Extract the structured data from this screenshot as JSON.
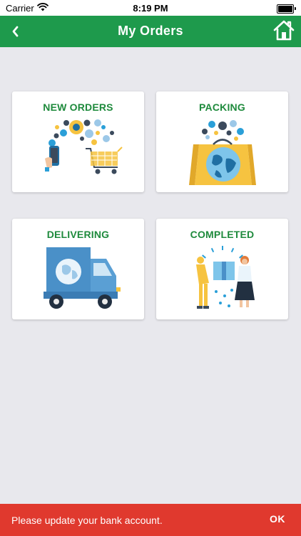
{
  "status_bar": {
    "carrier": "Carrier",
    "time": "8:19 PM",
    "wifi_icon": "wifi-icon",
    "battery_icon": "battery-icon"
  },
  "nav": {
    "title": "My Orders",
    "back_icon": "chevron-left-icon",
    "home_icon": "home-icon"
  },
  "cards": [
    {
      "label": "NEW ORDERS",
      "icon": "online-shopping-cart-icon"
    },
    {
      "label": "PACKING",
      "icon": "package-bag-icon"
    },
    {
      "label": "DELIVERING",
      "icon": "delivery-truck-icon"
    },
    {
      "label": "COMPLETED",
      "icon": "package-handover-icon"
    }
  ],
  "snackbar": {
    "message": "Please update your bank account.",
    "action": "OK"
  },
  "colors": {
    "primary": "#1e9a4c",
    "card_label": "#1e8a3c",
    "background": "#e8e8ed",
    "snackbar": "#e0392e"
  }
}
